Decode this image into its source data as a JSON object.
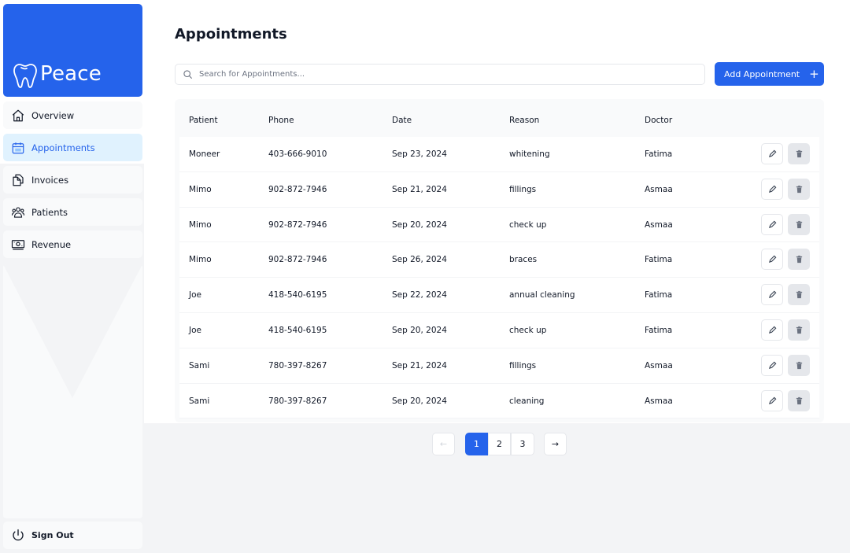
{
  "brand": {
    "name": "Peace",
    "logo_icon": "tooth-icon",
    "color": "#2563eb"
  },
  "sidebar": {
    "items": [
      {
        "label": "Overview",
        "icon": "home-icon",
        "active": false
      },
      {
        "label": "Appointments",
        "icon": "calendar-icon",
        "active": true
      },
      {
        "label": "Invoices",
        "icon": "documents-icon",
        "active": false
      },
      {
        "label": "Patients",
        "icon": "users-icon",
        "active": false
      },
      {
        "label": "Revenue",
        "icon": "money-icon",
        "active": false
      }
    ],
    "signout": {
      "label": "Sign Out",
      "icon": "power-icon"
    }
  },
  "main": {
    "title": "Appointments",
    "search": {
      "placeholder": "Search for Appointments...",
      "value": ""
    },
    "add_button": {
      "label": "Add Appointment",
      "icon": "plus-icon"
    },
    "table": {
      "columns": [
        "Patient",
        "Phone",
        "Date",
        "Reason",
        "Doctor"
      ],
      "rows": [
        {
          "patient": "Moneer",
          "phone": "403-666-9010",
          "date": "Sep 23, 2024",
          "reason": "whitening",
          "doctor": "Fatima"
        },
        {
          "patient": "Mimo",
          "phone": "902-872-7946",
          "date": "Sep 21, 2024",
          "reason": "fillings",
          "doctor": "Asmaa"
        },
        {
          "patient": "Mimo",
          "phone": "902-872-7946",
          "date": "Sep 20, 2024",
          "reason": "check up",
          "doctor": "Asmaa"
        },
        {
          "patient": "Mimo",
          "phone": "902-872-7946",
          "date": "Sep 26, 2024",
          "reason": "braces",
          "doctor": "Fatima"
        },
        {
          "patient": "Joe",
          "phone": "418-540-6195",
          "date": "Sep 22, 2024",
          "reason": "annual cleaning",
          "doctor": "Fatima"
        },
        {
          "patient": "Joe",
          "phone": "418-540-6195",
          "date": "Sep 20, 2024",
          "reason": "check up",
          "doctor": "Fatima"
        },
        {
          "patient": "Sami",
          "phone": "780-397-8267",
          "date": "Sep 21, 2024",
          "reason": "fillings",
          "doctor": "Asmaa"
        },
        {
          "patient": "Sami",
          "phone": "780-397-8267",
          "date": "Sep 20, 2024",
          "reason": "cleaning",
          "doctor": "Asmaa"
        }
      ],
      "row_actions": {
        "edit_icon": "pencil-icon",
        "delete_icon": "trash-icon"
      }
    },
    "pagination": {
      "prev": "←",
      "next": "→",
      "pages": [
        "1",
        "2",
        "3"
      ],
      "current": "1"
    }
  }
}
